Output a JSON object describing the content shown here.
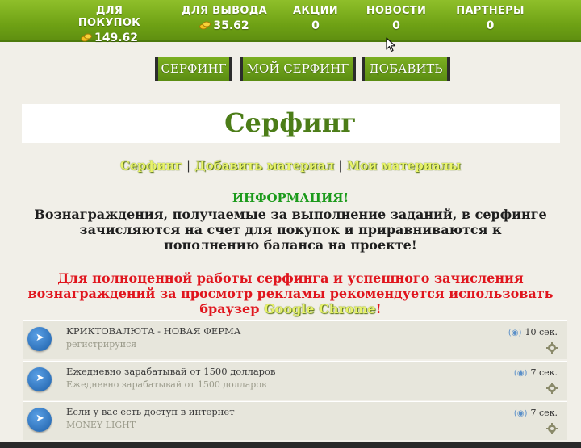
{
  "stats": [
    {
      "label": "ДЛЯ ПОКУПОК",
      "value": "149.62",
      "coin": true
    },
    {
      "label": "ДЛЯ ВЫВОДА",
      "value": "35.62",
      "coin": true
    },
    {
      "label": "АКЦИИ",
      "value": "0",
      "coin": false
    },
    {
      "label": "НОВОСТИ",
      "value": "0",
      "coin": false
    },
    {
      "label": "ПАРТНЕРЫ",
      "value": "0",
      "coin": false
    }
  ],
  "nav": [
    "СЕРФИНГ",
    "МОЙ СЕРФИНГ",
    "ДОБАВИТЬ"
  ],
  "page_title": "Серфинг",
  "sublinks": [
    "Серфинг",
    "Добавить материал",
    "Мои материалы"
  ],
  "sublink_separator": "|",
  "info": {
    "heading": "ИНФОРМАЦИЯ!",
    "body": "Вознаграждения, получаемые за выполнение заданий, в серфинге зачисляются на счет для покупок и приравниваются к пополнению баланса на проекте!"
  },
  "warning": {
    "text": "Для полноценной работы серфинга и успешного зачисления вознаграждений за просмотр рекламы рекомендуется использовать браузер",
    "browser": "Google Chrome",
    "end": "!"
  },
  "tasks": [
    {
      "title": "КРИКТОВАЛЮТА - НОВАЯ ФЕРМА",
      "subtitle": "регистрируйся",
      "time": "10 сек."
    },
    {
      "title": "Ежедневно зарабатывай от 1500 долларов",
      "subtitle": "Ежедневно зарабатывай от 1500 долларов",
      "time": "7 сек."
    },
    {
      "title": "Если у вас есть доступ в интернет",
      "subtitle": "MONEY LIGHT",
      "time": "7 сек."
    }
  ],
  "colors": {
    "accent_green": "#6fa215",
    "title_green": "#4c7d18",
    "warning_red": "#e0151d",
    "info_green": "#1b9a1b"
  },
  "icons": [
    "coins-icon",
    "play-arrow-icon",
    "eye-icon",
    "gear-icon",
    "mouse-cursor-icon"
  ]
}
